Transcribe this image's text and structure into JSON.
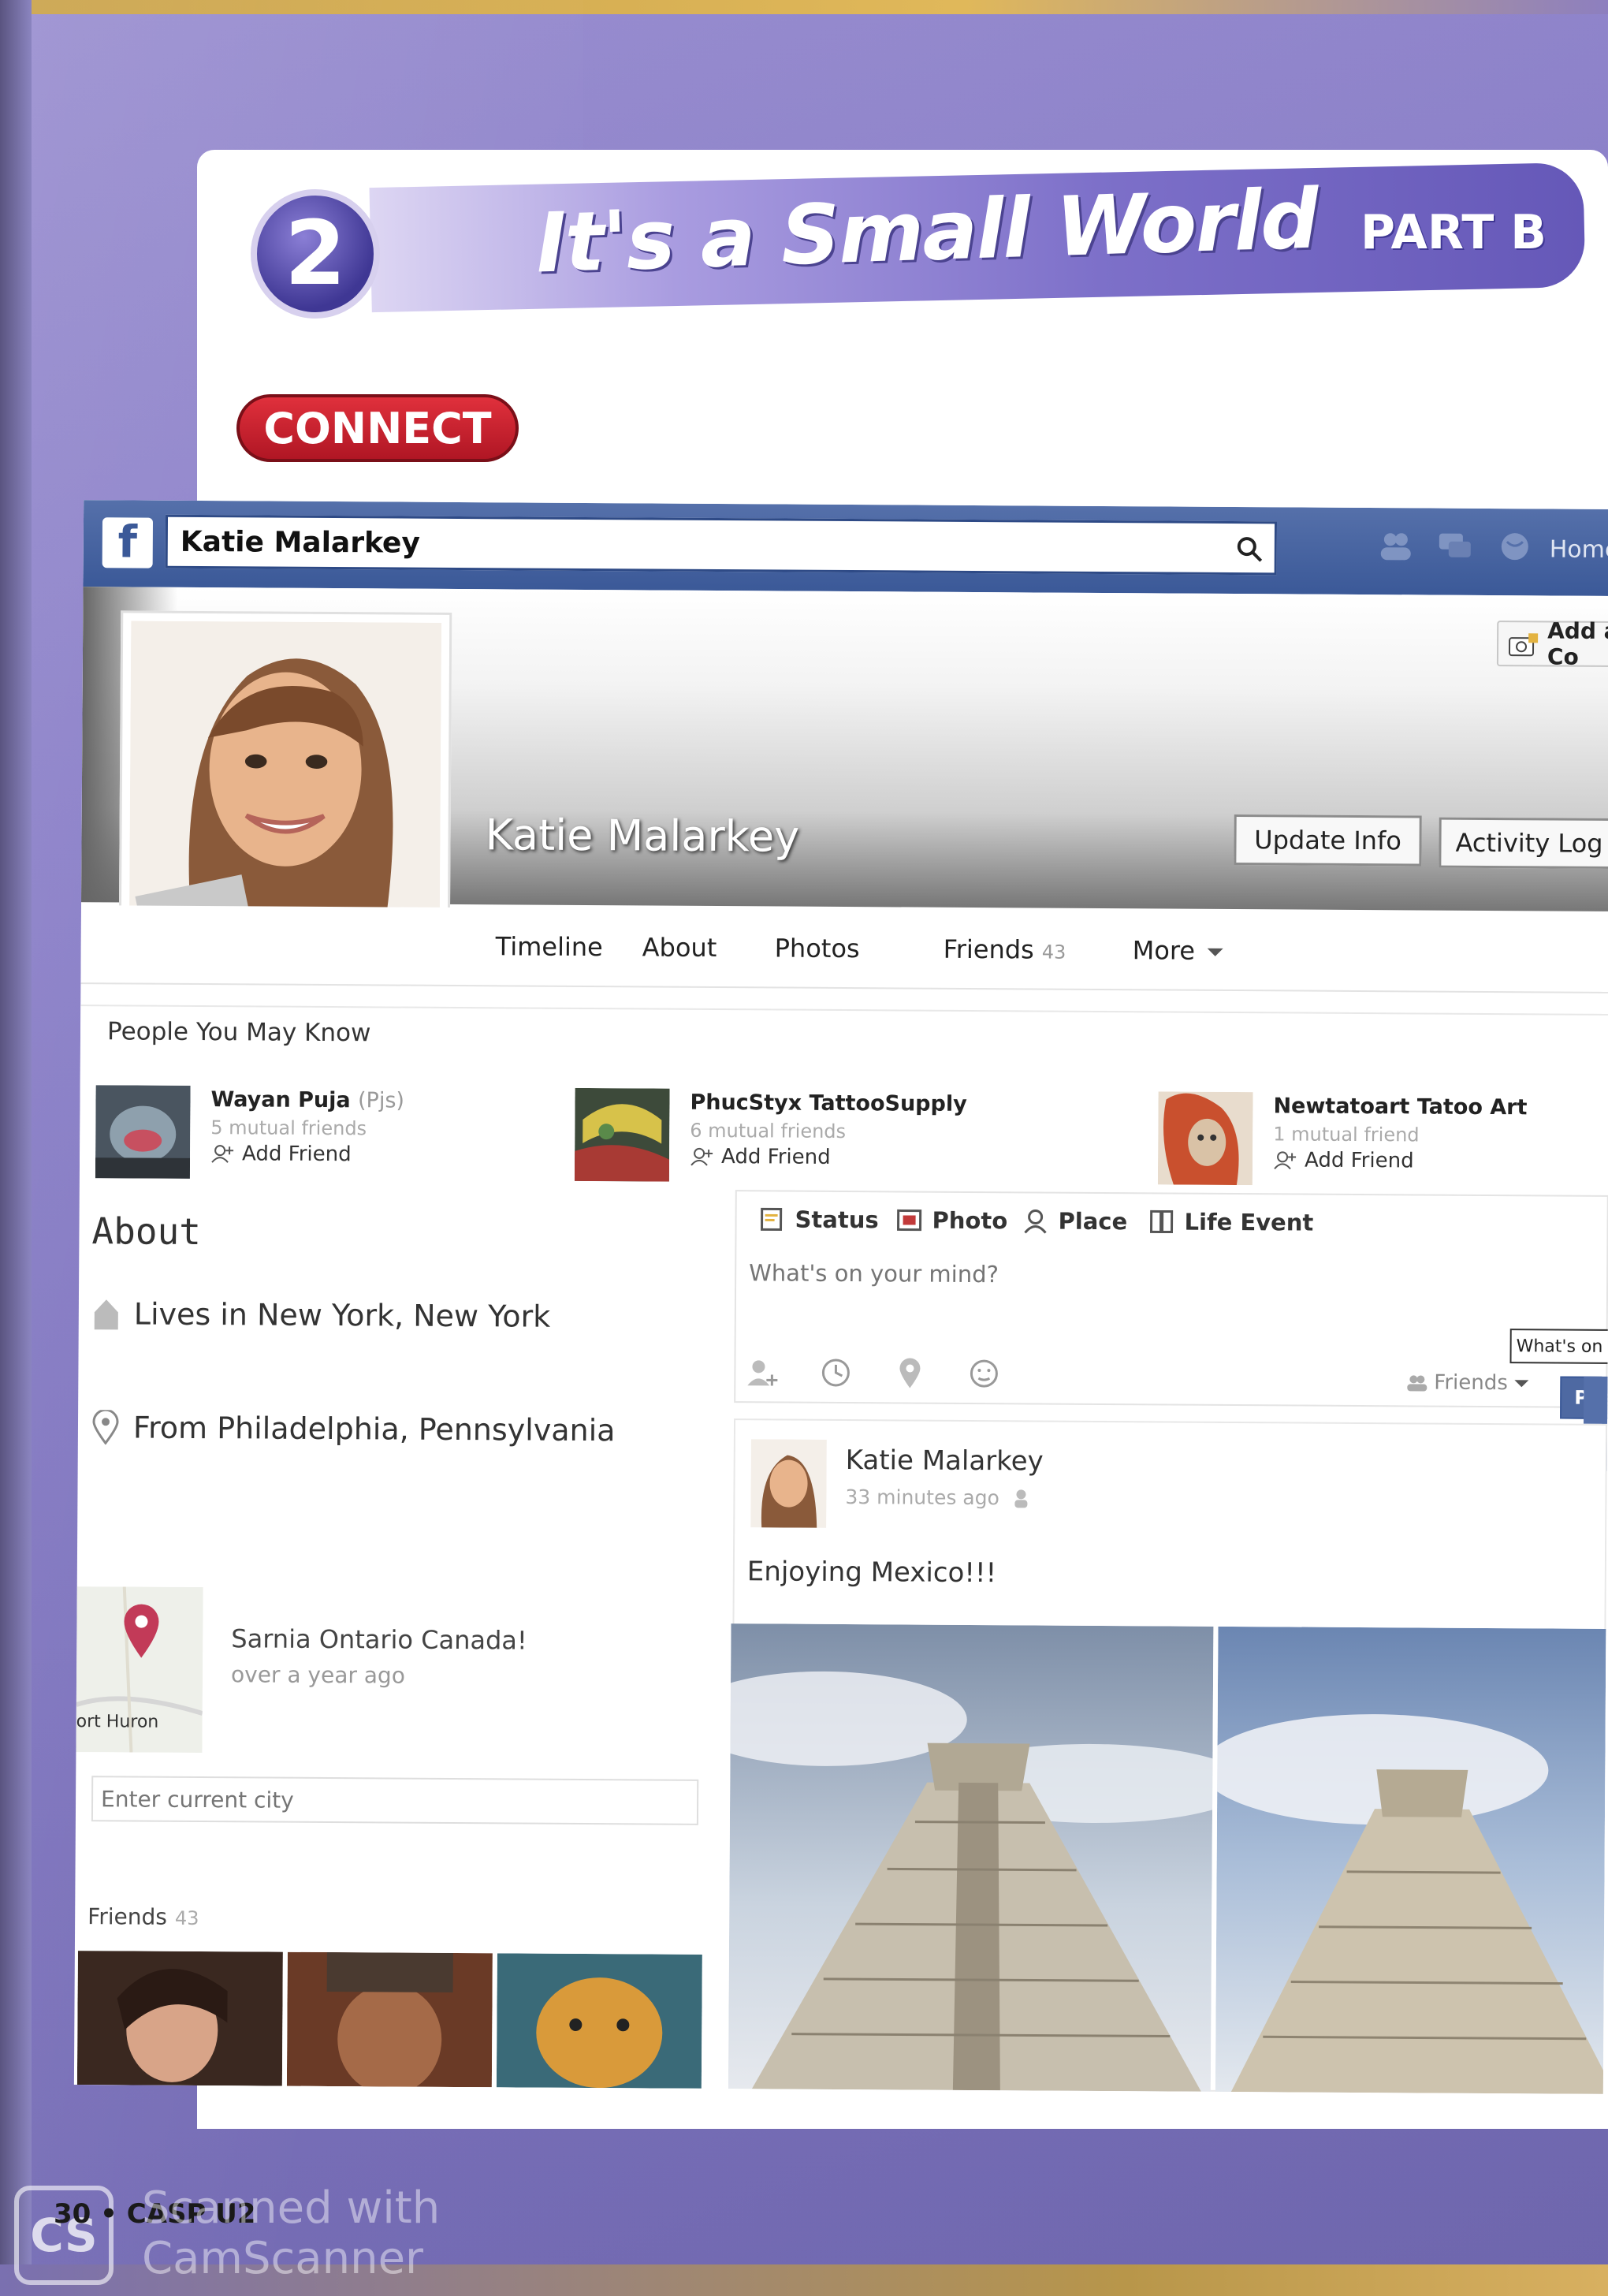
{
  "unit": {
    "number": "2",
    "title": "It's a Small World",
    "part": "PART B"
  },
  "section": {
    "label": "CONNECT"
  },
  "facebook": {
    "search_value": "Katie Malarkey",
    "home_label": "Home",
    "add_cover_label": "Add a Co",
    "profile_name": "Katie Malarkey",
    "buttons": {
      "update_info": "Update Info",
      "activity_log": "Activity Log"
    },
    "tabs": [
      {
        "label": "Timeline"
      },
      {
        "label": "About"
      },
      {
        "label": "Photos"
      },
      {
        "label": "Friends",
        "count": "43"
      },
      {
        "label": "More"
      }
    ],
    "people_you_may_know": {
      "title": "People You May Know",
      "people": [
        {
          "name": "Wayan Puja",
          "alt": "(Pjs)",
          "mutual": "5 mutual friends",
          "action": "Add Friend"
        },
        {
          "name": "PhucStyx TattooSupply",
          "alt": "",
          "mutual": "6 mutual friends",
          "action": "Add Friend"
        },
        {
          "name": "Newtatoart Tatoo Art",
          "alt": "",
          "mutual": "1 mutual friend",
          "action": "Add Friend"
        }
      ]
    },
    "about": {
      "title": "About",
      "lives_in": "Lives in New York, New York",
      "from": "From Philadelphia, Pennsylvania",
      "checkin": {
        "place": "Sarnia Ontario Canada!",
        "time": "over a year ago",
        "map_label": "ort Huron"
      },
      "city_placeholder": "Enter current city"
    },
    "friends_box": {
      "title": "Friends",
      "count": "43"
    },
    "composer": {
      "tabs": [
        "Status",
        "Photo",
        "Place",
        "Life Event"
      ],
      "placeholder": "What's on your mind?",
      "audience": "Friends",
      "tooltip": "What's on yo",
      "post_label": "Post"
    },
    "story": {
      "author": "Katie Malarkey",
      "time": "33 minutes ago",
      "text": "Enjoying Mexico!!!"
    }
  },
  "footer": {
    "page_label": "30 • CASP U2",
    "watermark_line1": "Scanned with",
    "watermark_line2": "CamScanner",
    "watermark_logo": "CS"
  }
}
